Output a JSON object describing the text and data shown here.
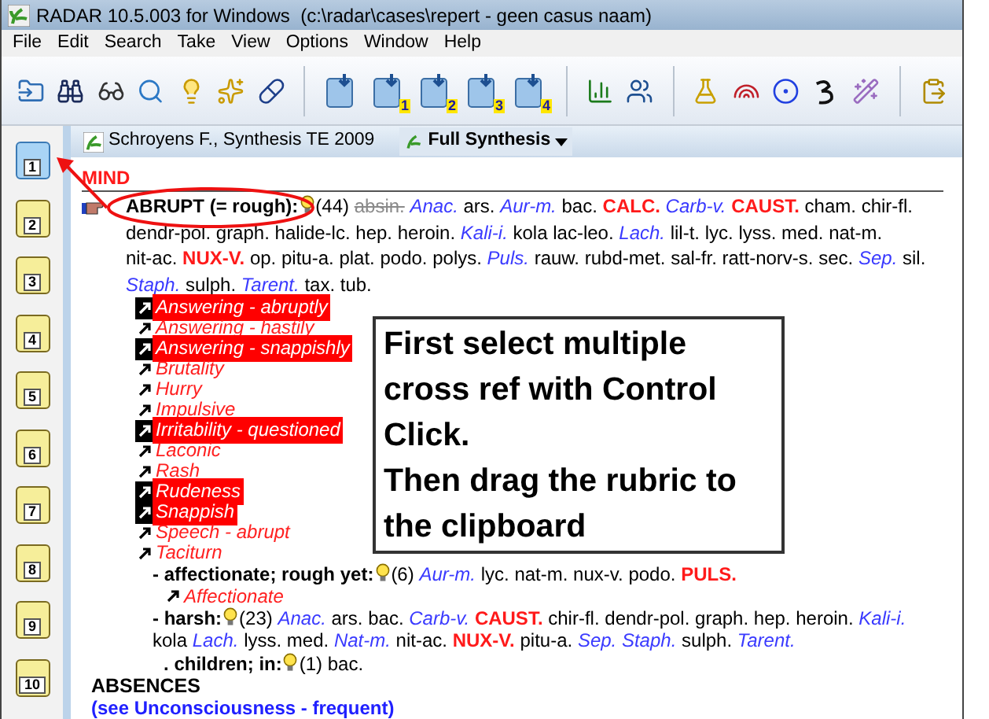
{
  "window": {
    "title": "RADAR 10.5.003 for Windows  (c:\\radar\\cases\\repert - geen casus naam)"
  },
  "menu": [
    "File",
    "Edit",
    "Search",
    "Take",
    "View",
    "Options",
    "Window",
    "Help"
  ],
  "toolbar": [
    {
      "kind": "open"
    },
    {
      "kind": "binoculars"
    },
    {
      "kind": "glasses"
    },
    {
      "kind": "search"
    },
    {
      "kind": "bulb"
    },
    {
      "kind": "bulb-wand"
    },
    {
      "kind": "pills"
    },
    {
      "kind": "separator"
    },
    {
      "kind": "clipboard"
    },
    {
      "kind": "clipboard",
      "badge": "1"
    },
    {
      "kind": "clipboard",
      "badge": "2"
    },
    {
      "kind": "clipboard",
      "badge": "3"
    },
    {
      "kind": "clipboard",
      "badge": "4"
    },
    {
      "kind": "separator"
    },
    {
      "kind": "chart"
    },
    {
      "kind": "people"
    },
    {
      "kind": "separator"
    },
    {
      "kind": "lamp"
    },
    {
      "kind": "rainbow"
    },
    {
      "kind": "ring"
    },
    {
      "kind": "glyph"
    },
    {
      "kind": "wizard"
    },
    {
      "kind": "separator"
    },
    {
      "kind": "clipboard-out"
    }
  ],
  "clipboards": [
    {
      "label": "1",
      "selected": true
    },
    {
      "label": "2",
      "selected": false
    },
    {
      "label": "3",
      "selected": false
    },
    {
      "label": "4",
      "selected": false
    },
    {
      "label": "5",
      "selected": false
    },
    {
      "label": "6",
      "selected": false
    },
    {
      "label": "7",
      "selected": false
    },
    {
      "label": "8",
      "selected": false
    },
    {
      "label": "9",
      "selected": false
    },
    {
      "label": "10",
      "selected": false
    }
  ],
  "book": {
    "title": "Schroyens F., Synthesis TE 2009",
    "view": "Full Synthesis"
  },
  "chapter": "MIND",
  "rubric": {
    "name": "ABRUPT (= rough):",
    "count": "(44)",
    "remedies": [
      {
        "name": "absin.",
        "kind": "struck"
      },
      {
        "name": "Anac.",
        "kind": "italic"
      },
      {
        "name": "ars.",
        "kind": "plain"
      },
      {
        "name": "Aur-m.",
        "kind": "italic"
      },
      {
        "name": "bac.",
        "kind": "plain"
      },
      {
        "name": "CALC.",
        "kind": "bold"
      },
      {
        "name": "Carb-v.",
        "kind": "italic"
      },
      {
        "name": "CAUST.",
        "kind": "bold"
      },
      {
        "name": "cham.",
        "kind": "plain"
      },
      {
        "name": "chir-fl.",
        "kind": "plain"
      },
      {
        "name": "dendr-pol.",
        "kind": "plain"
      },
      {
        "name": "graph.",
        "kind": "plain"
      },
      {
        "name": "halide-lc.",
        "kind": "plain"
      },
      {
        "name": "hep.",
        "kind": "plain"
      },
      {
        "name": "heroin.",
        "kind": "plain"
      },
      {
        "name": "Kali-i.",
        "kind": "italic"
      },
      {
        "name": "kola",
        "kind": "plain"
      },
      {
        "name": "lac-leo.",
        "kind": "plain"
      },
      {
        "name": "Lach.",
        "kind": "italic"
      },
      {
        "name": "lil-t.",
        "kind": "plain"
      },
      {
        "name": "lyc.",
        "kind": "plain"
      },
      {
        "name": "lyss.",
        "kind": "plain"
      },
      {
        "name": "med.",
        "kind": "plain"
      },
      {
        "name": "nat-m.",
        "kind": "plain"
      },
      {
        "name": "nit-ac.",
        "kind": "plain"
      },
      {
        "name": "NUX-V.",
        "kind": "bold"
      },
      {
        "name": "op.",
        "kind": "plain"
      },
      {
        "name": "pitu-a.",
        "kind": "plain"
      },
      {
        "name": "plat.",
        "kind": "plain"
      },
      {
        "name": "podo.",
        "kind": "plain"
      },
      {
        "name": "polys.",
        "kind": "plain"
      },
      {
        "name": "Puls.",
        "kind": "italic"
      },
      {
        "name": "rauw.",
        "kind": "plain"
      },
      {
        "name": "rubd-met.",
        "kind": "plain"
      },
      {
        "name": "sal-fr.",
        "kind": "plain"
      },
      {
        "name": "ratt-norv-s.",
        "kind": "plain"
      },
      {
        "name": "sec.",
        "kind": "plain"
      },
      {
        "name": "Sep.",
        "kind": "italic"
      },
      {
        "name": "sil.",
        "kind": "plain"
      },
      {
        "name": "Staph.",
        "kind": "italic"
      },
      {
        "name": "sulph.",
        "kind": "plain"
      },
      {
        "name": "Tarent.",
        "kind": "italic"
      },
      {
        "name": "tax.",
        "kind": "plain"
      },
      {
        "name": "tub.",
        "kind": "plain"
      }
    ],
    "cross_refs": [
      {
        "label": "Answering - abruptly",
        "selected": true
      },
      {
        "label": "Answering - hastily",
        "selected": false
      },
      {
        "label": "Answering - snappishly",
        "selected": true
      },
      {
        "label": "Brutality",
        "selected": false
      },
      {
        "label": "Hurry",
        "selected": false
      },
      {
        "label": "Impulsive",
        "selected": false
      },
      {
        "label": "Irritability - questioned",
        "selected": true
      },
      {
        "label": "Laconic",
        "selected": false
      },
      {
        "label": "Rash",
        "selected": false
      },
      {
        "label": "Rudeness",
        "selected": true
      },
      {
        "label": "Snappish",
        "selected": true
      },
      {
        "label": "Speech - abrupt",
        "selected": false
      },
      {
        "label": "Taciturn",
        "selected": false
      }
    ],
    "children": [
      {
        "prefix": "-",
        "name": "affectionate; rough yet:",
        "count": "(6)",
        "remedies": [
          {
            "name": "Aur-m.",
            "kind": "italic"
          },
          {
            "name": "lyc.",
            "kind": "plain"
          },
          {
            "name": "nat-m.",
            "kind": "plain"
          },
          {
            "name": "nux-v.",
            "kind": "plain"
          },
          {
            "name": "podo.",
            "kind": "plain"
          },
          {
            "name": "PULS.",
            "kind": "bold"
          }
        ],
        "cross_refs": [
          {
            "label": "Affectionate",
            "selected": false
          }
        ]
      },
      {
        "prefix": "-",
        "name": "harsh:",
        "count": "(23)",
        "remedies": [
          {
            "name": "Anac.",
            "kind": "italic"
          },
          {
            "name": "ars.",
            "kind": "plain"
          },
          {
            "name": "bac.",
            "kind": "plain"
          },
          {
            "name": "Carb-v.",
            "kind": "italic"
          },
          {
            "name": "CAUST.",
            "kind": "bold"
          },
          {
            "name": "chir-fl.",
            "kind": "plain"
          },
          {
            "name": "dendr-pol.",
            "kind": "plain"
          },
          {
            "name": "graph.",
            "kind": "plain"
          },
          {
            "name": "hep.",
            "kind": "plain"
          },
          {
            "name": "heroin.",
            "kind": "plain"
          },
          {
            "name": "Kali-i.",
            "kind": "italic"
          },
          {
            "name": "kola",
            "kind": "plain"
          },
          {
            "name": "Lach.",
            "kind": "italic"
          },
          {
            "name": "lyss.",
            "kind": "plain"
          },
          {
            "name": "med.",
            "kind": "plain"
          },
          {
            "name": "Nat-m.",
            "kind": "italic"
          },
          {
            "name": "nit-ac.",
            "kind": "plain"
          },
          {
            "name": "NUX-V.",
            "kind": "bold"
          },
          {
            "name": "pitu-a.",
            "kind": "plain"
          },
          {
            "name": "Sep.",
            "kind": "italic"
          },
          {
            "name": "Staph.",
            "kind": "italic"
          },
          {
            "name": "sulph.",
            "kind": "plain"
          },
          {
            "name": "Tarent.",
            "kind": "italic"
          }
        ],
        "children": [
          {
            "prefix": ".",
            "name": "children; in:",
            "count": "(1)",
            "remedies": [
              {
                "name": "bac.",
                "kind": "plain"
              }
            ]
          }
        ]
      }
    ]
  },
  "next_rubric": "ABSENCES",
  "see_link": "(see Unconsciousness - frequent)",
  "note": [
    "First select multiple cross ref with Control Click.",
    "Then drag the rubric to the clipboard"
  ]
}
